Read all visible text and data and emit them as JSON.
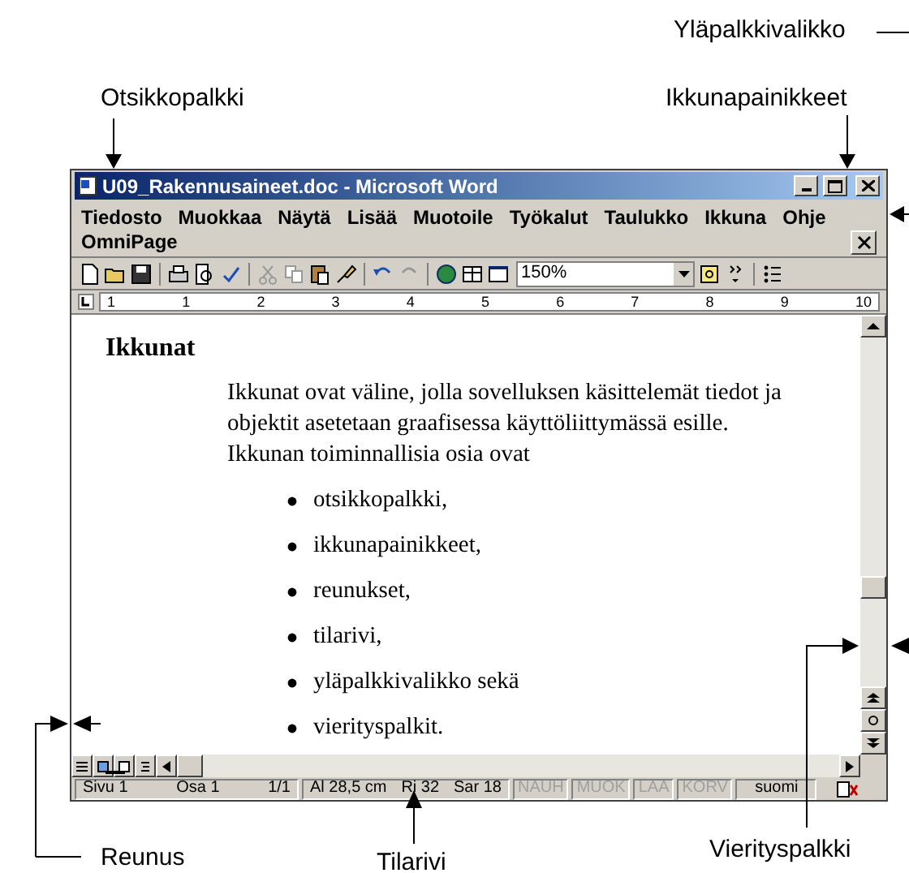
{
  "labels": {
    "menu_bar": "Yläpalkkivalikko",
    "title_bar": "Otsikkopalkki",
    "window_buttons": "Ikkunapainikkeet",
    "border": "Reunus",
    "status_bar": "Tilarivi",
    "scrollbar": "Vierityspalkki"
  },
  "window": {
    "title": "U09_Rakennusaineet.doc - Microsoft Word"
  },
  "menu": [
    "Tiedosto",
    "Muokkaa",
    "Näytä",
    "Lisää",
    "Muotoile",
    "Työkalut",
    "Taulukko",
    "Ikkuna",
    "Ohje"
  ],
  "menu_row_2": "OmniPage",
  "toolbar": {
    "zoom": "150%"
  },
  "ruler_labels": [
    "1",
    "1",
    "2",
    "3",
    "4",
    "5",
    "6",
    "7",
    "8",
    "9",
    "10"
  ],
  "document": {
    "heading": "Ikkunat",
    "paragraphs": [
      "Ikkunat ovat väline,  jolla sovelluksen käsittelemät tiedot ja objektit asetetaan graafisessa käyttöliittymässä esille.",
      "Ikkunan toiminnallisia osia ovat"
    ],
    "bullets": [
      "otsikkopalkki,",
      "ikkunapainikkeet,",
      "reunukset,",
      "tilarivi,",
      "yläpalkkivalikko sekä",
      "vierityspalkit."
    ]
  },
  "status_bar": [
    {
      "text": "Sivu 1",
      "disabled": false
    },
    {
      "text": "Osa 1",
      "disabled": false
    },
    {
      "text": "1/1",
      "disabled": false
    },
    {
      "text": "Al 28,5 cm",
      "disabled": false
    },
    {
      "text": "Ri 32",
      "disabled": false
    },
    {
      "text": "Sar 18",
      "disabled": false
    },
    {
      "text": "NAUH",
      "disabled": true
    },
    {
      "text": "MUOK",
      "disabled": true
    },
    {
      "text": "LAA",
      "disabled": true
    },
    {
      "text": "KORV",
      "disabled": true
    },
    {
      "text": "suomi",
      "disabled": false
    }
  ]
}
